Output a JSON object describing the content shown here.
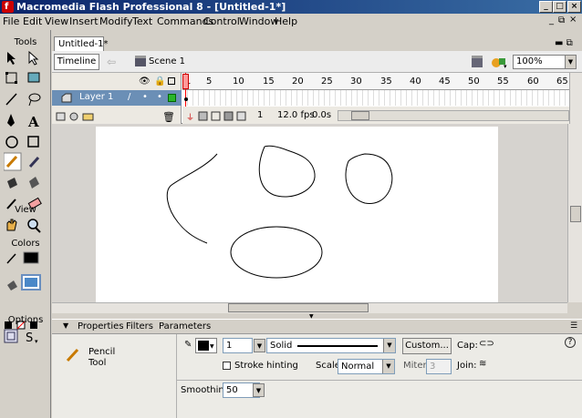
{
  "window": {
    "title": "Macromedia Flash Professional 8 - [Untitled-1*]",
    "logo_letter": "f"
  },
  "menu": [
    "File",
    "Edit",
    "View",
    "Insert",
    "Modify",
    "Text",
    "Commands",
    "Control",
    "Window",
    "Help"
  ],
  "tools": {
    "title": "Tools",
    "view_title": "View",
    "colors_title": "Colors",
    "options_title": "Options",
    "stroke_color": "#000000",
    "fill_color": "#4a88c8"
  },
  "document": {
    "tab": "Untitled-1*",
    "timeline_button": "Timeline",
    "scene": "Scene 1",
    "zoom": "100%"
  },
  "timeline": {
    "layer_name": "Layer 1",
    "frame_numbers": [
      "1",
      "5",
      "10",
      "15",
      "20",
      "25",
      "30",
      "35",
      "40",
      "45",
      "50",
      "55",
      "60",
      "65"
    ],
    "current_frame": "1",
    "frame_rate": "12.0 fps",
    "elapsed": "0.0s"
  },
  "properties": {
    "tabs": [
      "Properties",
      "Filters",
      "Parameters"
    ],
    "tool_name": "Pencil",
    "tool_sub": "Tool",
    "stroke_height": "1",
    "stroke_style": "Solid",
    "custom_button": "Custom...",
    "cap_label": "Cap:",
    "stroke_hinting": "Stroke hinting",
    "scale_label": "Scale:",
    "scale_value": "Normal",
    "miter_label": "Miter:",
    "miter_value": "3",
    "join_label": "Join:",
    "smoothing_label": "Smoothing",
    "smoothing_value": "50",
    "help_icon": "?"
  },
  "colors": {
    "titlebar": "#0a246a",
    "stage": "#ffffff",
    "playhead": "#ff0000",
    "layer_outline": "#00aa00"
  }
}
